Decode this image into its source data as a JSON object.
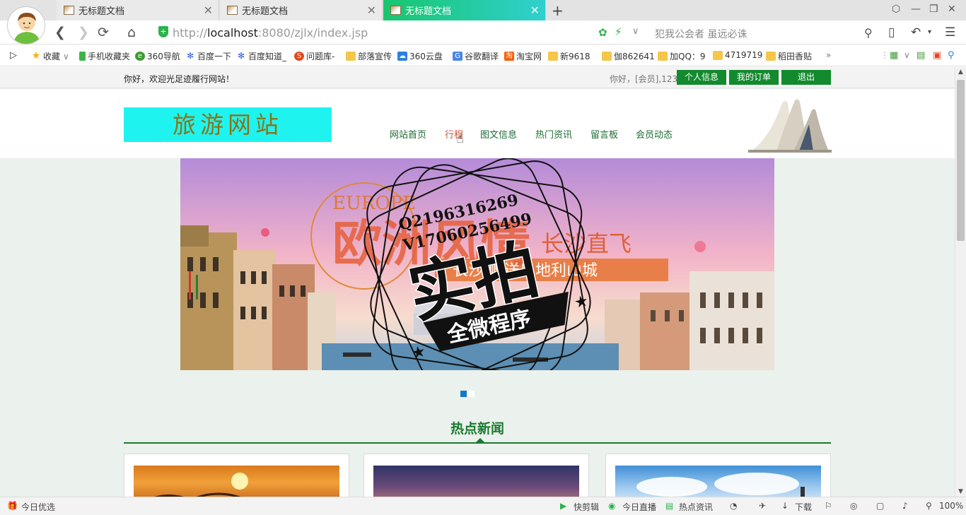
{
  "browser": {
    "tabs": [
      {
        "title": "无标题文档",
        "active": false
      },
      {
        "title": "无标题文档",
        "active": false
      },
      {
        "title": "无标题文档",
        "active": true
      }
    ],
    "new_tab_label": "+",
    "url_prefix": "http://",
    "url_host": "localhost",
    "url_rest": ":8080/zjlx/index.jsp",
    "search_hint": "犯我公会者 虽远必诛",
    "zoom": "100%",
    "bookmarks": [
      {
        "label": "收藏",
        "icon": "star-icon"
      },
      {
        "label": "手机收藏夹",
        "icon": "phone-icon"
      },
      {
        "label": "360导航",
        "icon": "360-icon"
      },
      {
        "label": "百度一下",
        "icon": "baidu-icon"
      },
      {
        "label": "百度知道_",
        "icon": "baidu-icon"
      },
      {
        "label": "问题库-",
        "icon": "sogou-icon"
      },
      {
        "label": "部落宣传",
        "icon": "folder-icon"
      },
      {
        "label": "360云盘",
        "icon": "cloud-icon"
      },
      {
        "label": "谷歌翻译",
        "icon": "translate-icon"
      },
      {
        "label": "淘宝网",
        "icon": "taobao-icon"
      },
      {
        "label": "新9618",
        "icon": "folder-icon"
      },
      {
        "label": "伽862641",
        "icon": "folder-icon"
      },
      {
        "label": "加QQ：9",
        "icon": "folder-icon"
      },
      {
        "label": "4719719",
        "icon": "folder-icon"
      },
      {
        "label": "稻田香贴",
        "icon": "folder-icon"
      }
    ],
    "status_left": "今日优选",
    "status_items": [
      "快剪辑",
      "今日直播",
      "热点资讯",
      "下载"
    ]
  },
  "site": {
    "welcome": "你好，欢迎光足迹履行网站！",
    "user_hello": "你好，[会员],123",
    "buttons": [
      "个人信息",
      "我的订单",
      "退出"
    ],
    "logo": "旅游网站",
    "nav": [
      "网站首页",
      "行程",
      "图文信息",
      "热门资讯",
      "留言板",
      "会员动态"
    ],
    "banner": {
      "europe": "EUROPE",
      "title": "欧洲风情",
      "direct": "长沙直飞",
      "gift": "长沙  赠送奥地利山城"
    },
    "watermark": {
      "line1": "Q2196316269",
      "line2": "V17060256499",
      "main": "实拍",
      "ribbon": "全微程序"
    },
    "section_title": "热点新闻"
  },
  "colors": {
    "brand_green": "#138a2e",
    "nav_green": "#1d6b33",
    "active_nav": "#c6553d",
    "logo_bg": "#1ff3f0",
    "page_bg": "#ebf1ec"
  }
}
